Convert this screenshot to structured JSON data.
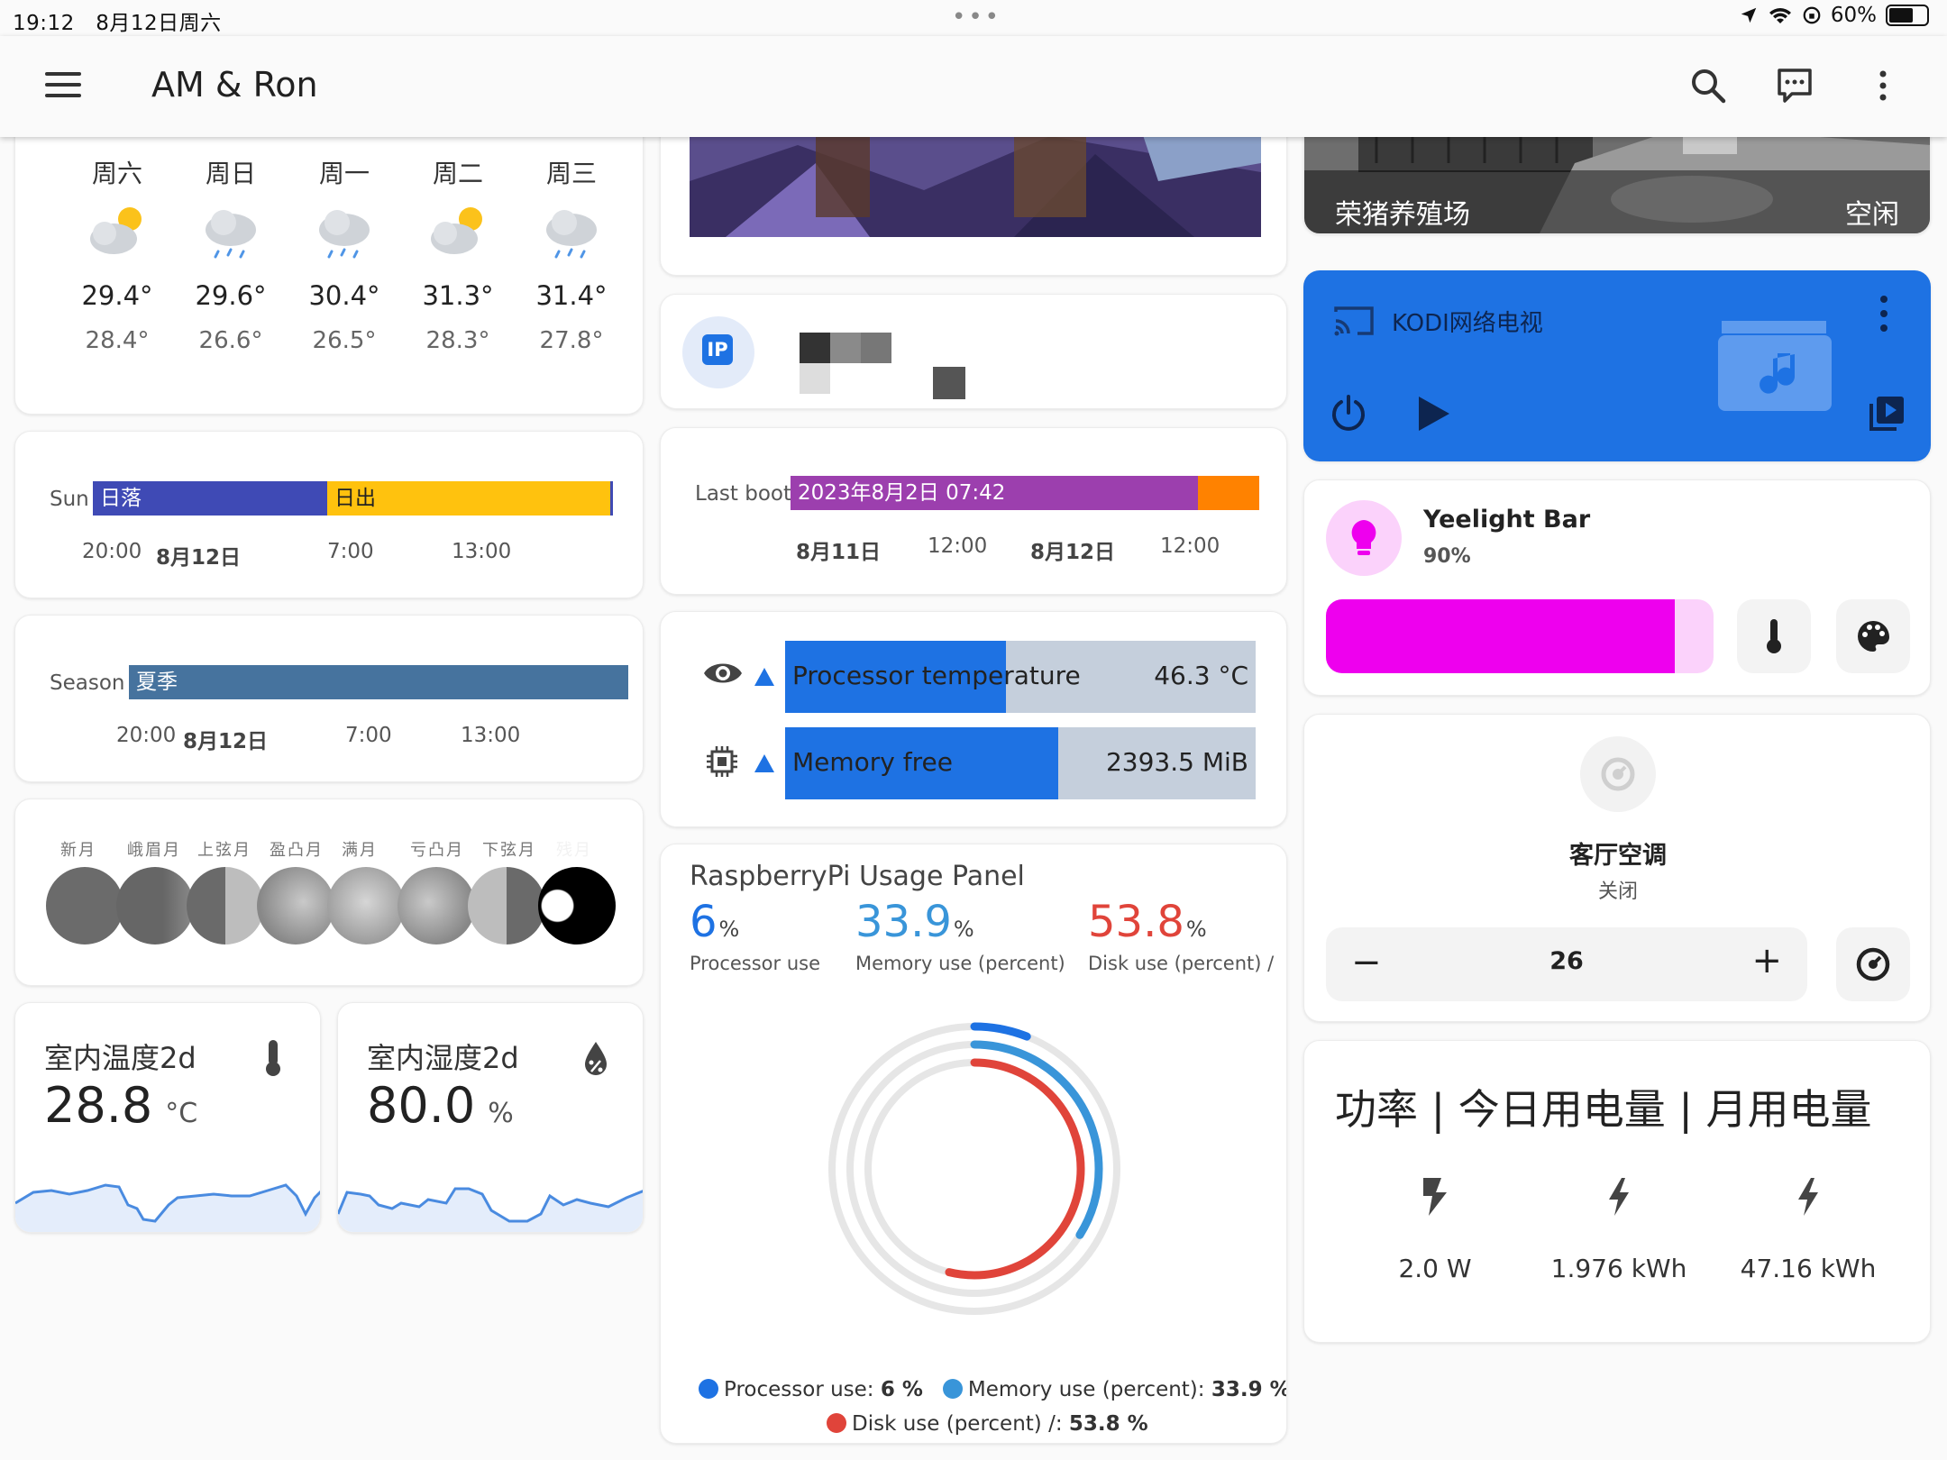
{
  "status": {
    "time": "19:12",
    "date": "8月12日周六",
    "battery": "60%"
  },
  "app": {
    "title": "AM & Ron"
  },
  "weather": {
    "days": [
      {
        "day": "周六",
        "icon": "partly-sunny-icon",
        "hi": "29.4°",
        "lo": "28.4°"
      },
      {
        "day": "周日",
        "icon": "rain-cloud-icon",
        "hi": "29.6°",
        "lo": "26.6°"
      },
      {
        "day": "周一",
        "icon": "rain-cloud-icon",
        "hi": "30.4°",
        "lo": "26.5°"
      },
      {
        "day": "周二",
        "icon": "partly-sunny-icon",
        "hi": "31.3°",
        "lo": "28.3°"
      },
      {
        "day": "周三",
        "icon": "rain-cloud-icon",
        "hi": "31.4°",
        "lo": "27.8°"
      }
    ]
  },
  "sun": {
    "label": "Sun",
    "seg1": "日落",
    "seg2": "日出",
    "ticks": [
      "20:00",
      "8月12日",
      "7:00",
      "13:00"
    ],
    "colors": {
      "night": "#3f4ab5",
      "day": "#ffc20e"
    }
  },
  "season": {
    "label": "Season",
    "seg1": "夏季",
    "ticks": [
      "20:00",
      "8月12日",
      "7:00",
      "13:00"
    ],
    "color": "#46739e"
  },
  "moon": {
    "phases": [
      "新月",
      "峨眉月",
      "上弦月",
      "盈凸月",
      "满月",
      "亏凸月",
      "下弦月",
      "残月"
    ]
  },
  "indoor_temp": {
    "title": "室内温度2d",
    "value": "28.8",
    "unit": "°C",
    "icon": "thermometer-icon"
  },
  "indoor_hum": {
    "title": "室内湿度2d",
    "value": "80.0",
    "unit": "%",
    "icon": "water-percent-icon"
  },
  "ip": {
    "badge": "IP"
  },
  "last_boot": {
    "label": "Last boot",
    "value": "2023年8月2日 07:42",
    "ticks": [
      "8月11日",
      "12:00",
      "8月12日",
      "12:00"
    ],
    "colors": {
      "main": "#9c3fae",
      "end": "#ff8200"
    }
  },
  "sensors": [
    {
      "name": "Processor temperature",
      "value": "46.3 °C",
      "fill": 0.47,
      "icon": "eye-icon"
    },
    {
      "name": "Memory free",
      "value": "2393.5 MiB",
      "fill": 0.58,
      "icon": "chip-icon"
    }
  ],
  "rpi": {
    "title": "RaspberryPi Usage Panel",
    "stats": [
      {
        "num": "6",
        "unit": "%",
        "label": "Processor use",
        "color": "#1e72e3"
      },
      {
        "num": "33.9",
        "unit": "%",
        "label": "Memory use (percent)",
        "color": "#3995d9"
      },
      {
        "num": "53.8",
        "unit": "%",
        "label": "Disk use (percent) /",
        "color": "#e0443a"
      }
    ],
    "values": {
      "processor": 6,
      "memory": 33.9,
      "disk": 53.8
    },
    "legend": {
      "p_name": "Processor use:",
      "p_val": "6 %",
      "m_name": "Memory use (percent):",
      "m_val": "33.9 %",
      "d_name": "Disk use (percent) /:",
      "d_val": "53.8 %"
    }
  },
  "camera": {
    "name": "荣猪养殖场",
    "state": "空闲"
  },
  "kodi": {
    "name": "KODI网络电视",
    "color": "#1e72e3"
  },
  "light": {
    "name": "Yeelight Bar",
    "brightness": "90%",
    "level": 0.9,
    "color": "#ee00ee"
  },
  "ac": {
    "name": "客厅空调",
    "state": "关闭",
    "temp": "26"
  },
  "power": {
    "title": "功率 | 今日用电量 | 月用电量",
    "items": [
      "2.0 W",
      "1.976 kWh",
      "47.16 kWh"
    ]
  }
}
